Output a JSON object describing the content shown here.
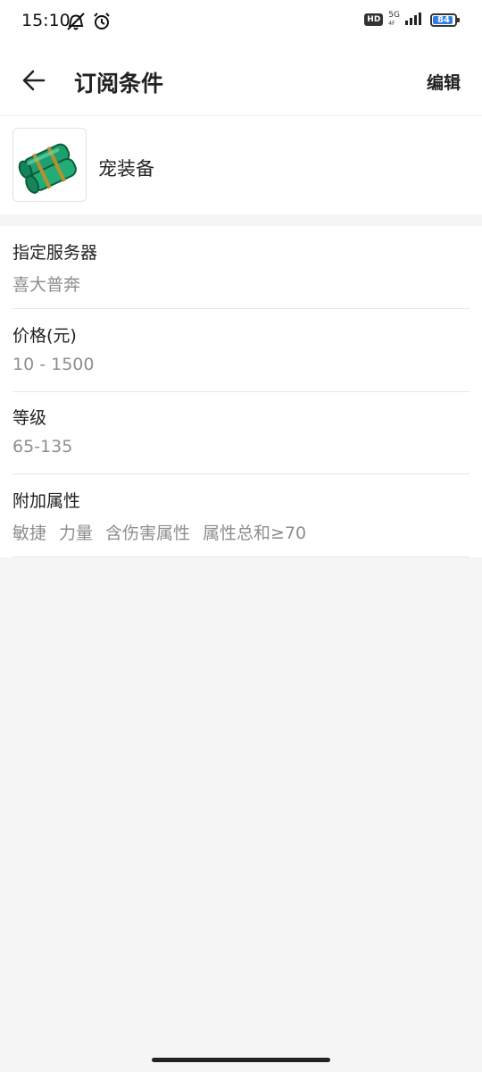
{
  "status_bar": {
    "time": "15:10",
    "hd": "HD",
    "network": "5G",
    "network_sub": "4F",
    "battery": "84",
    "battery_level": 0.84,
    "icons": [
      "mute-icon",
      "alarm-icon",
      "signal-icon",
      "battery-icon"
    ]
  },
  "header": {
    "title": "订阅条件",
    "edit_label": "编辑",
    "back_icon": "back-arrow-icon"
  },
  "item": {
    "name": "宠装备",
    "thumbnail_icon": "pet-equipment-icon"
  },
  "conditions": [
    {
      "label": "指定服务器",
      "value": "喜大普奔"
    },
    {
      "label": "价格(元)",
      "value": "10 - 1500"
    },
    {
      "label": "等级",
      "value": "65-135"
    }
  ],
  "attributes": {
    "label": "附加属性",
    "tags": [
      "敏捷",
      "力量",
      "含伤害属性",
      "属性总和≥70"
    ]
  },
  "colors": {
    "background": "#f5f5f5",
    "text_primary": "#222222",
    "text_secondary": "#8e8e8e",
    "battery_accent": "#2f7fe0",
    "item_green": "#1f9e6e"
  }
}
